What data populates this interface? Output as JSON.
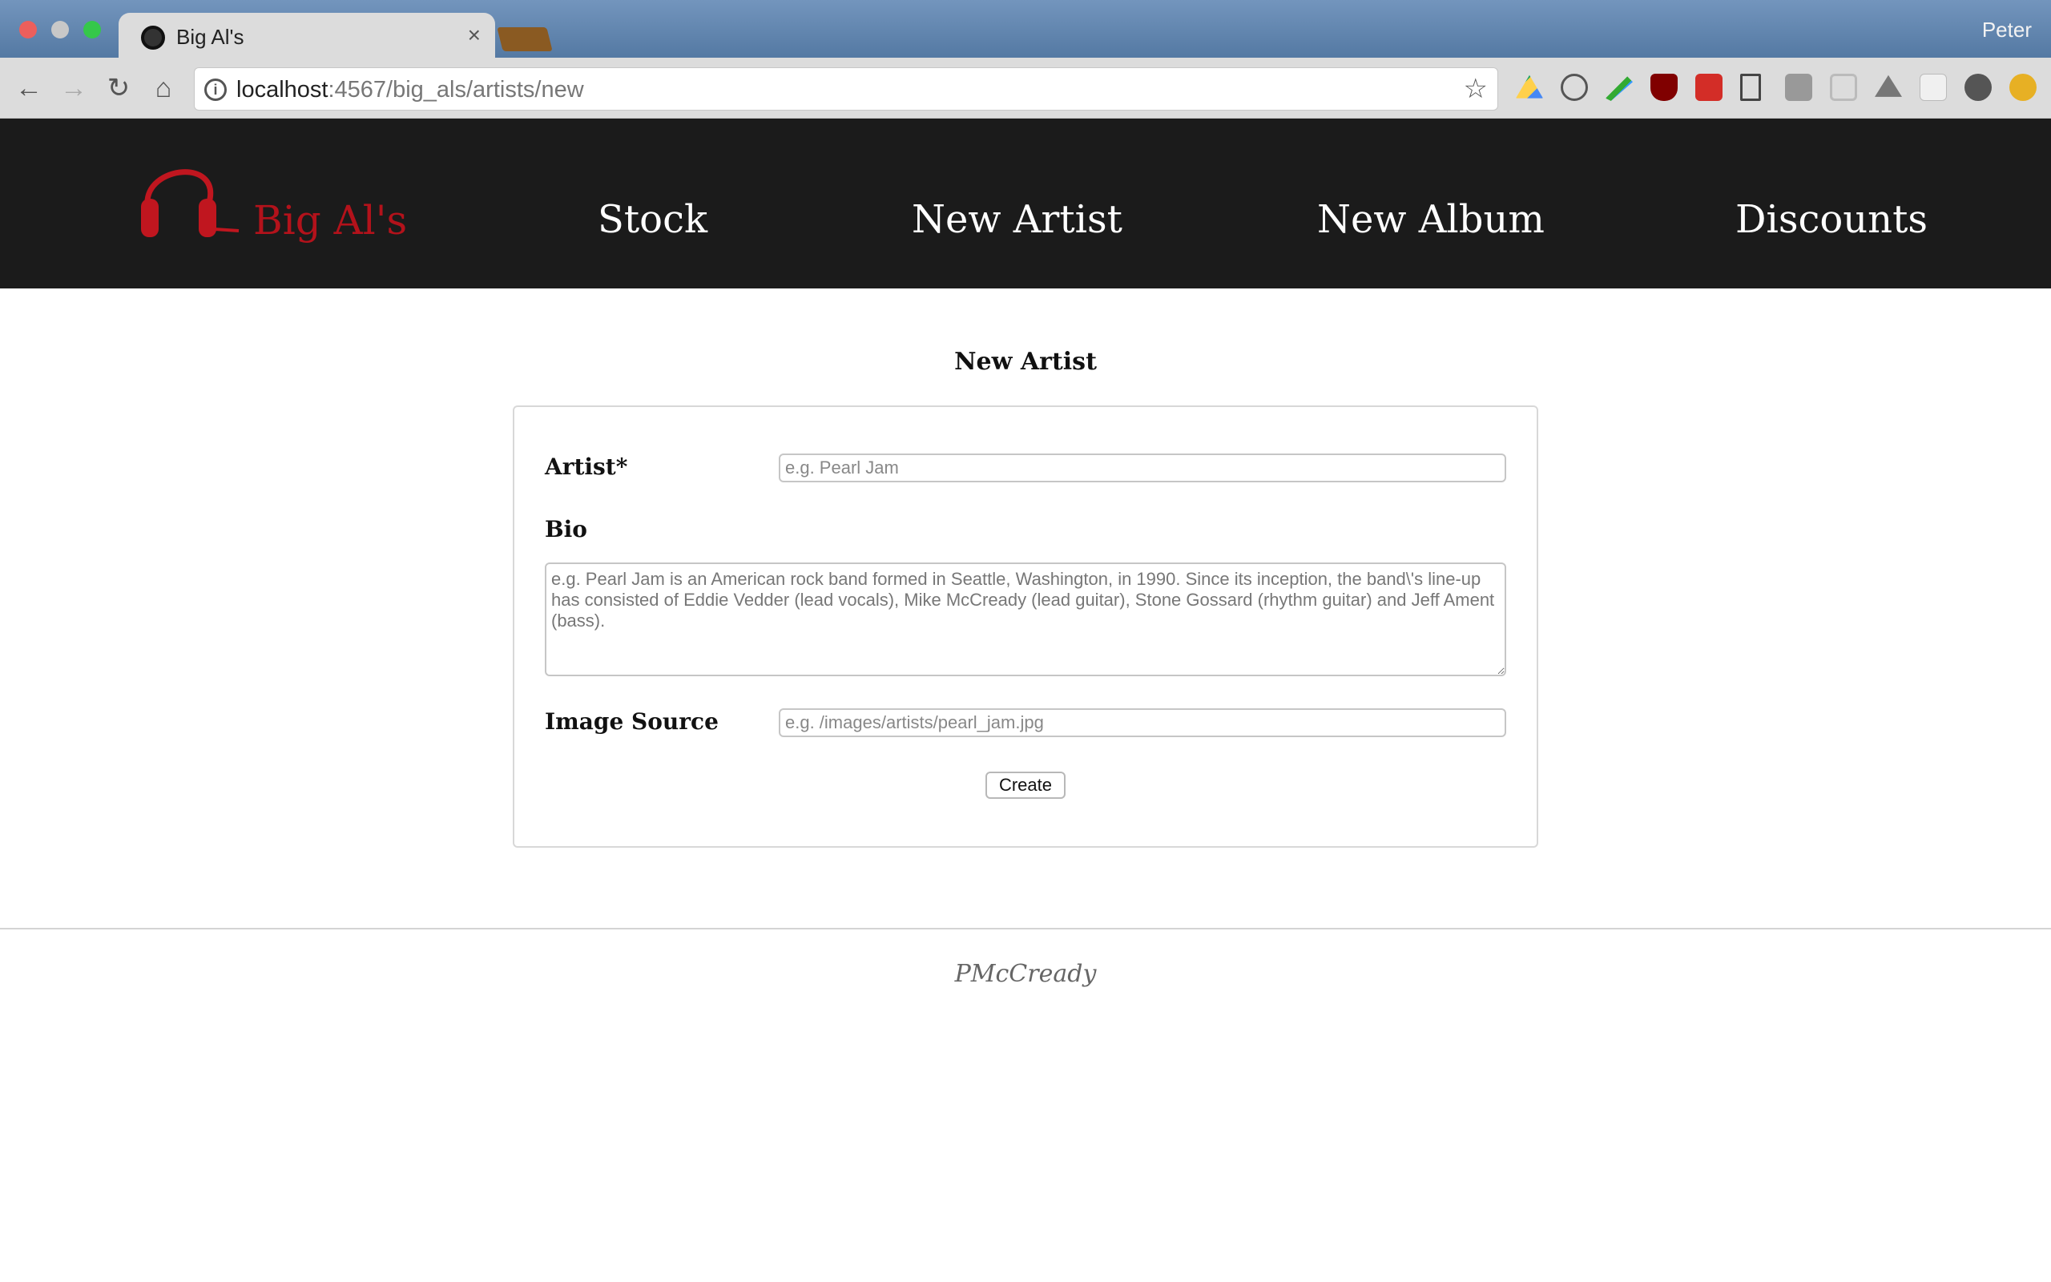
{
  "browser": {
    "tab_title": "Big Al's",
    "tab_close": "×",
    "profile_name": "Peter",
    "url_host": "localhost",
    "url_rest": ":4567/big_als/artists/new",
    "back_icon": "←",
    "forward_icon": "→",
    "reload_icon": "↻",
    "home_icon": "⌂",
    "info_icon": "i",
    "star_icon": "☆",
    "extension_icons": [
      "google-drive-icon",
      "d-extension-icon",
      "pen-extension-icon",
      "ublock-icon",
      "lastpass-icon",
      "page-icon",
      "window-icon",
      "cast-icon",
      "drive-alt-icon",
      "blank-extension-icon",
      "settings-extension-icon",
      "alert-extension-icon"
    ]
  },
  "header": {
    "brand": "Big Al's",
    "nav": [
      "Stock",
      "New Artist",
      "New Album",
      "Discounts"
    ],
    "brand_color": "#b3121b"
  },
  "main": {
    "title": "New Artist",
    "form": {
      "artist_label": "Artist*",
      "artist_placeholder": "e.g. Pearl Jam",
      "bio_label": "Bio",
      "bio_placeholder": "e.g. Pearl Jam is an American rock band formed in Seattle, Washington, in 1990. Since its inception, the band\\'s line-up has consisted of Eddie Vedder (lead vocals), Mike McCready (lead guitar), Stone Gossard (rhythm guitar) and Jeff Ament (bass).",
      "image_label": "Image Source",
      "image_placeholder": "e.g. /images/artists/pearl_jam.jpg",
      "submit_label": "Create"
    }
  },
  "footer": {
    "text": "PMcCready"
  }
}
